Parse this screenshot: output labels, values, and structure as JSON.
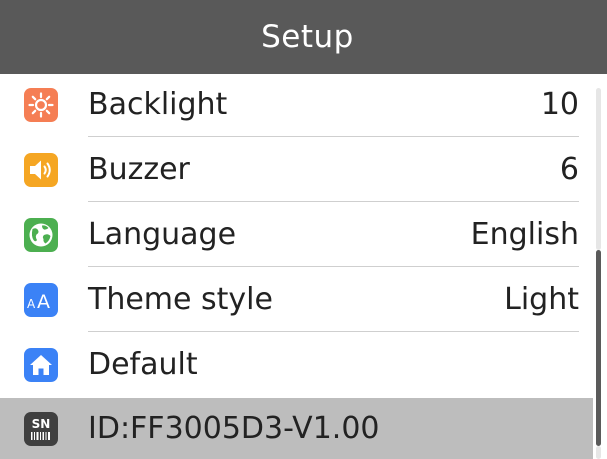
{
  "header": {
    "title": "Setup"
  },
  "menu": [
    {
      "label": "Backlight",
      "value": "10",
      "icon": "sun-icon",
      "icon_color": "#f57e54"
    },
    {
      "label": "Buzzer",
      "value": "6",
      "icon": "speaker-icon",
      "icon_color": "#f5a623"
    },
    {
      "label": "Language",
      "value": "English",
      "icon": "globe-icon",
      "icon_color": "#4caf50"
    },
    {
      "label": "Theme style",
      "value": "Light",
      "icon": "font-size-icon",
      "icon_color": "#3b82f6"
    },
    {
      "label": "Default",
      "value": "",
      "icon": "home-icon",
      "icon_color": "#3b82f6"
    },
    {
      "label": "ID:FF3005D3-V1.00",
      "value": "",
      "icon": "serial-number-icon",
      "icon_color": "#3f3f3f",
      "icon_text": "SN"
    }
  ],
  "colors": {
    "header_bg": "#595959",
    "selected_row_bg": "#bdbdbd",
    "scroll_thumb": "#5a5a5a"
  },
  "scroll": {
    "position_fraction": 0.55
  }
}
